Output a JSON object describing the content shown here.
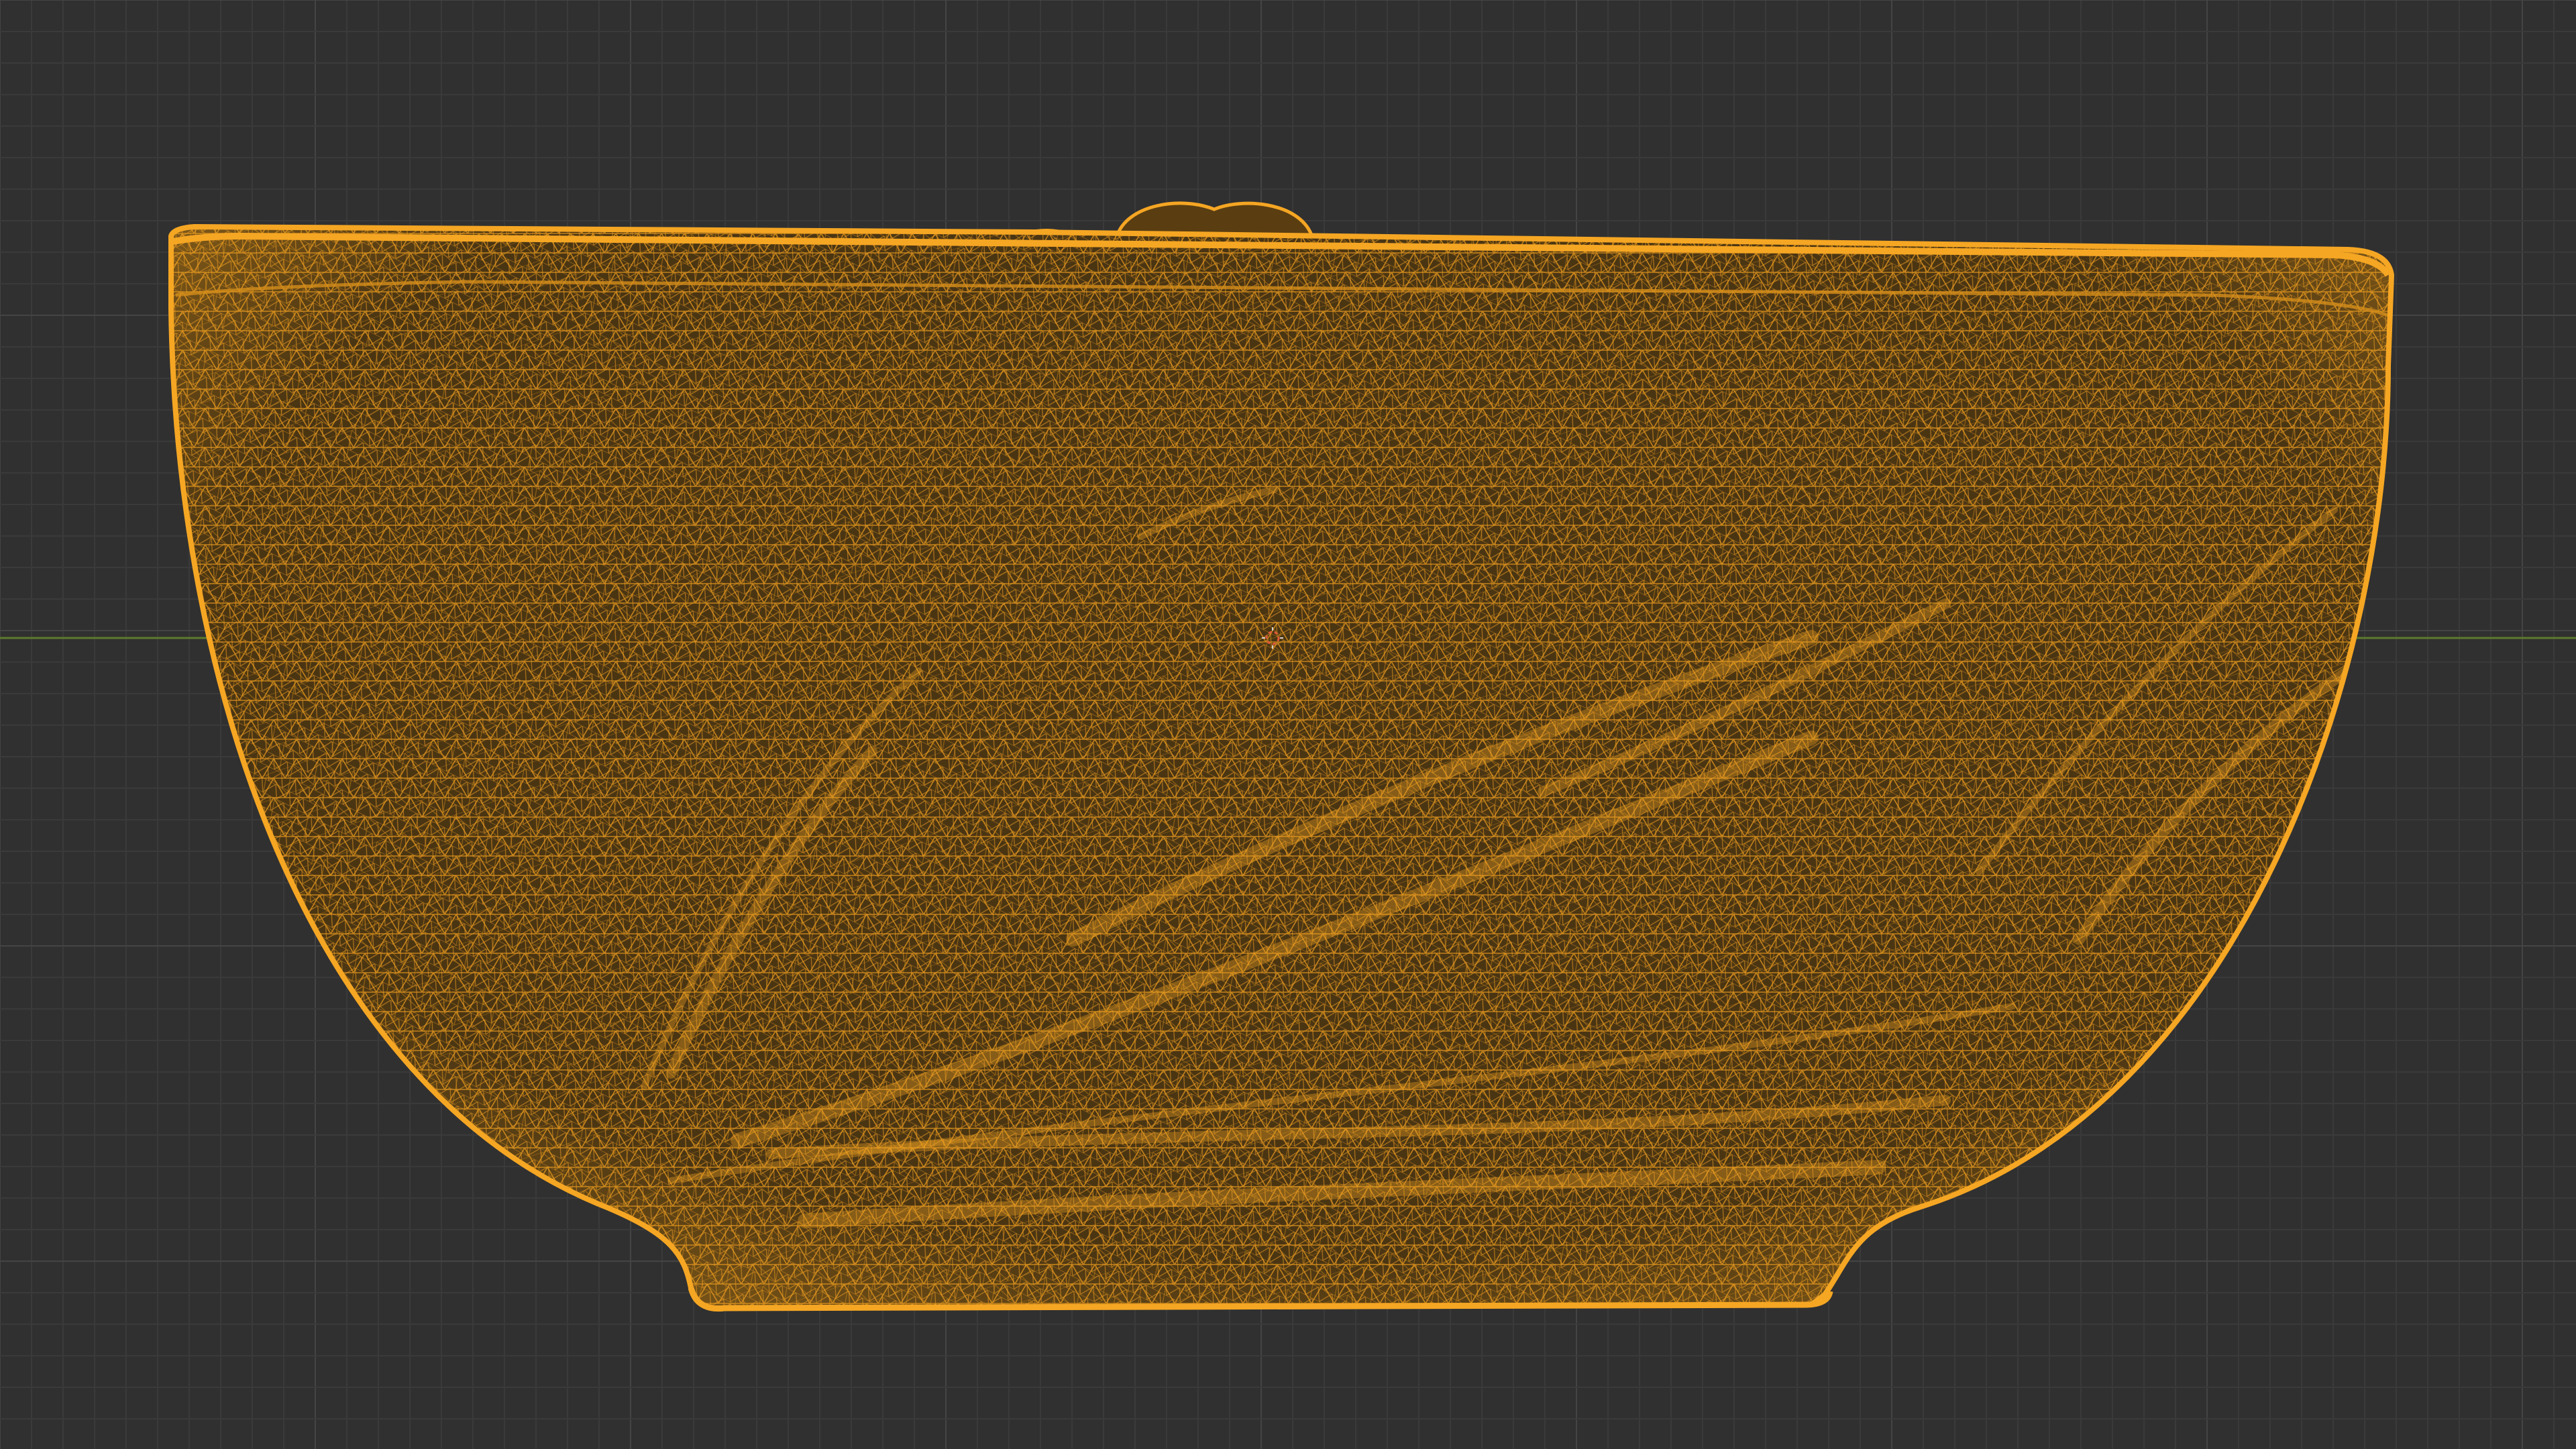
{
  "viewport": {
    "mode": "wireframe",
    "view": "orthographic-front",
    "object": "bowl-mesh",
    "selected": true,
    "grid": true,
    "show_x_axis": true,
    "show_3d_cursor": true
  },
  "colors": {
    "background": "#303030",
    "grid_minor": "#3a3a3a",
    "grid_major": "#444444",
    "x_axis": "#5d7a2c",
    "wire_selected": "#f5a623",
    "wire_fill": "#8a5a14",
    "wire_dark": "#2a1d08",
    "cursor": "#e05a3a"
  }
}
